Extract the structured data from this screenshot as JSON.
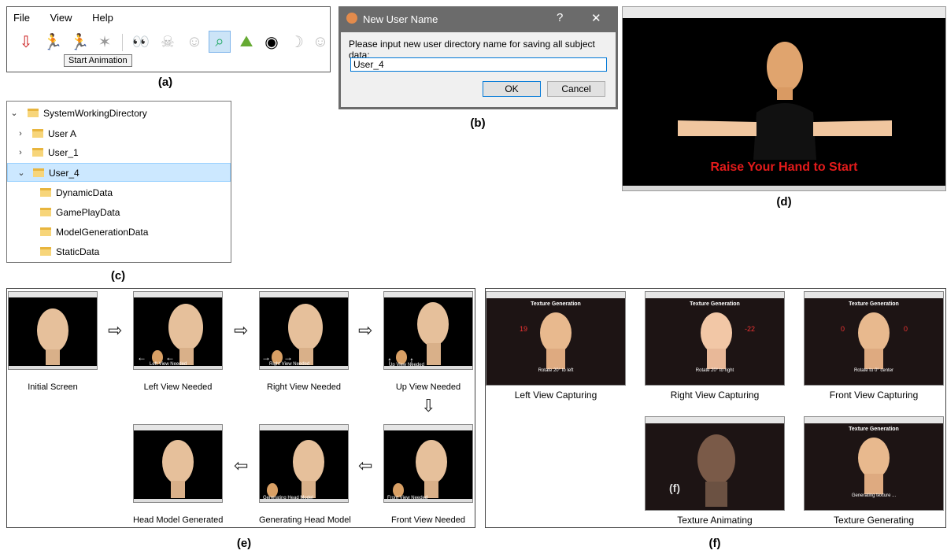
{
  "panel_a": {
    "menu": [
      "File",
      "View",
      "Help"
    ],
    "tooltip": "Start Animation",
    "caption": "(a)",
    "tool_icons": [
      "import-icon",
      "run-icon",
      "run-color-icon",
      "run-disabled-icon",
      "eyes-icon",
      "skull-icon",
      "head-icon",
      "analysis-icon",
      "landscape-icon",
      "eye-icon",
      "face-side-icon",
      "face-icon"
    ]
  },
  "panel_b": {
    "title": "New User Name",
    "help": "?",
    "close": "✕",
    "prompt": "Please input new user directory name for saving all subject data:",
    "value": "User_4",
    "ok": "OK",
    "cancel": "Cancel",
    "caption": "(b)"
  },
  "panel_c": {
    "root": "SystemWorkingDirectory",
    "items": [
      {
        "label": "User A"
      },
      {
        "label": "User_1"
      },
      {
        "label": "User_4"
      }
    ],
    "children": [
      "DynamicData",
      "GamePlayData",
      "ModelGenerationData",
      "StaticData"
    ],
    "caption": "(c)"
  },
  "panel_d": {
    "message": "Raise Your Hand to Start",
    "caption": "(d)"
  },
  "panel_e": {
    "steps": [
      "Initial Screen",
      "Left View Needed",
      "Right View Needed",
      "Up View Needed",
      "Front View Needed",
      "Generating Head Model",
      "Head Model Generated"
    ],
    "caption": "(e)"
  },
  "panel_f": {
    "screen_title": "Texture Generation",
    "tiles": [
      {
        "label": "Left View Capturing",
        "num_left": "19",
        "num_right": "",
        "instruction": "Rotate 20° to left"
      },
      {
        "label": "Right View Capturing",
        "num_left": "",
        "num_right": "-22",
        "instruction": "Rotate 20° to right"
      },
      {
        "label": "Front View Capturing",
        "num_left": "0",
        "num_right": "0",
        "instruction": "Rotate to 0° center"
      },
      {
        "label": "Texture Animating",
        "num_left": "",
        "num_right": "",
        "instruction": ""
      },
      {
        "label": "Texture Generating",
        "num_left": "",
        "num_right": "",
        "instruction": "Generating texture ..."
      }
    ],
    "overlay": "(f)",
    "caption": "(f)"
  },
  "colors": {
    "skin": "#e8b98e",
    "accent_red": "#e31b1b",
    "selection": "#cce8ff"
  }
}
